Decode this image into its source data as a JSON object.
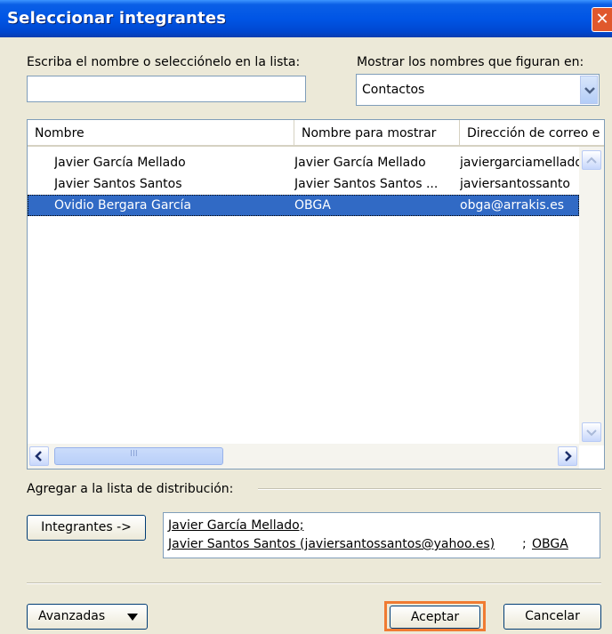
{
  "window": {
    "title": "Seleccionar integrantes",
    "close_glyph": "✕"
  },
  "search": {
    "label": "Escriba el nombre o selecciónelo en la lista:",
    "value": ""
  },
  "show_in": {
    "label": "Mostrar los nombres que figuran en:",
    "selected": "Contactos"
  },
  "list": {
    "columns": [
      "Nombre",
      "Nombre para mostrar",
      "Dirección de correo e"
    ],
    "rows": [
      {
        "name": "Javier García Mellado",
        "display": "Javier García Mellado",
        "email": "javiergarciamelladd",
        "selected": false
      },
      {
        "name": "Javier Santos Santos",
        "display": "Javier Santos Santos ...",
        "email": "javiersantossanto",
        "selected": false
      },
      {
        "name": "Ovidio Bergara García",
        "display": "OBGA",
        "email": "obga@arrakis.es",
        "selected": true
      }
    ],
    "hscroll_grip": "III"
  },
  "distribution": {
    "label": "Agregar a la lista de distribución:",
    "members_button": "Integrantes ->",
    "members_line1": "Javier García Mellado;",
    "members_line2_a": "Javier Santos Santos (javiersantossantos@yahoo.es)",
    "members_line2_sep": ";",
    "members_line2_b": "OBGA"
  },
  "footer": {
    "advanced": "Avanzadas",
    "ok": "Aceptar",
    "cancel": "Cancelar"
  },
  "colors": {
    "titlebar": "#0055e5",
    "selection": "#316ac5",
    "highlight": "#f07b32",
    "close": "#e0582d",
    "dialog_bg": "#ece9d8"
  },
  "icons": {
    "close": "close-icon",
    "dropdown": "chevron-down-icon",
    "scroll_up": "scroll-up-icon",
    "scroll_down": "scroll-down-icon",
    "scroll_left": "scroll-left-icon",
    "scroll_right": "scroll-right-icon",
    "menu_arrow": "caret-down-icon"
  }
}
